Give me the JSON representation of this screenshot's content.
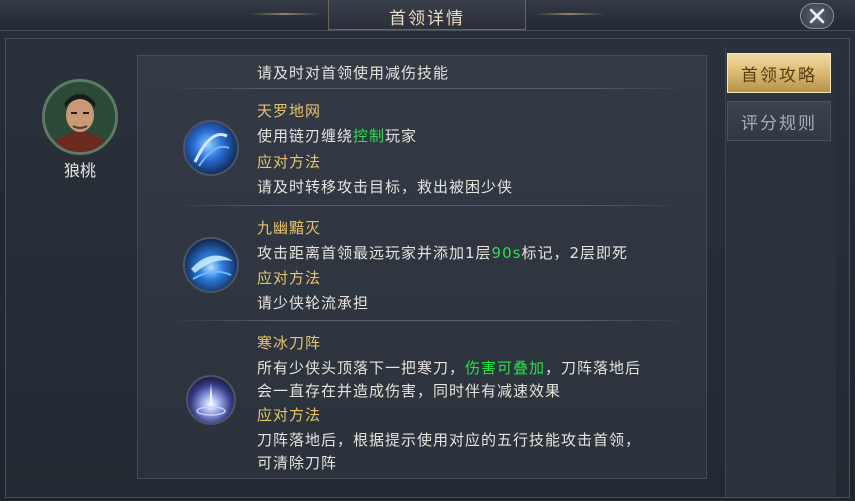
{
  "window": {
    "title": "首领详情"
  },
  "boss": {
    "name": "狼桃"
  },
  "tabs": [
    {
      "label": "首领攻略",
      "active": true
    },
    {
      "label": "评分规则",
      "active": false
    }
  ],
  "top_text": "请及时对首领使用减伤技能",
  "skills": [
    {
      "name": "天罗地网",
      "icon": "blue-swirl-skill-icon",
      "desc_parts": [
        "使用链刃缠绕",
        "控制",
        "玩家"
      ],
      "method_label": "应对方法",
      "method_lines": [
        "请及时转移攻击目标，救出被困少侠"
      ]
    },
    {
      "name": "九幽黯灭",
      "icon": "blue-blade-skill-icon",
      "desc_parts": [
        "攻击距离首领最远玩家并添加1层",
        "90s",
        "标记，2层即死"
      ],
      "method_label": "应对方法",
      "method_lines": [
        "请少侠轮流承担"
      ]
    },
    {
      "name": "寒冰刀阵",
      "icon": "ice-blade-array-skill-icon",
      "desc_parts": [
        "所有少侠头顶落下一把寒刀，",
        "伤害可叠加",
        "，刀阵落地后"
      ],
      "desc_line2": "会一直存在并造成伤害，同时伴有减速效果",
      "method_label": "应对方法",
      "method_lines": [
        "刀阵落地后，根据提示使用对应的五行技能攻击首领，",
        "可清除刀阵"
      ]
    }
  ],
  "colors": {
    "highlight": "#27e14a",
    "gold": "#e7c36e",
    "text": "#e6e3dc"
  }
}
